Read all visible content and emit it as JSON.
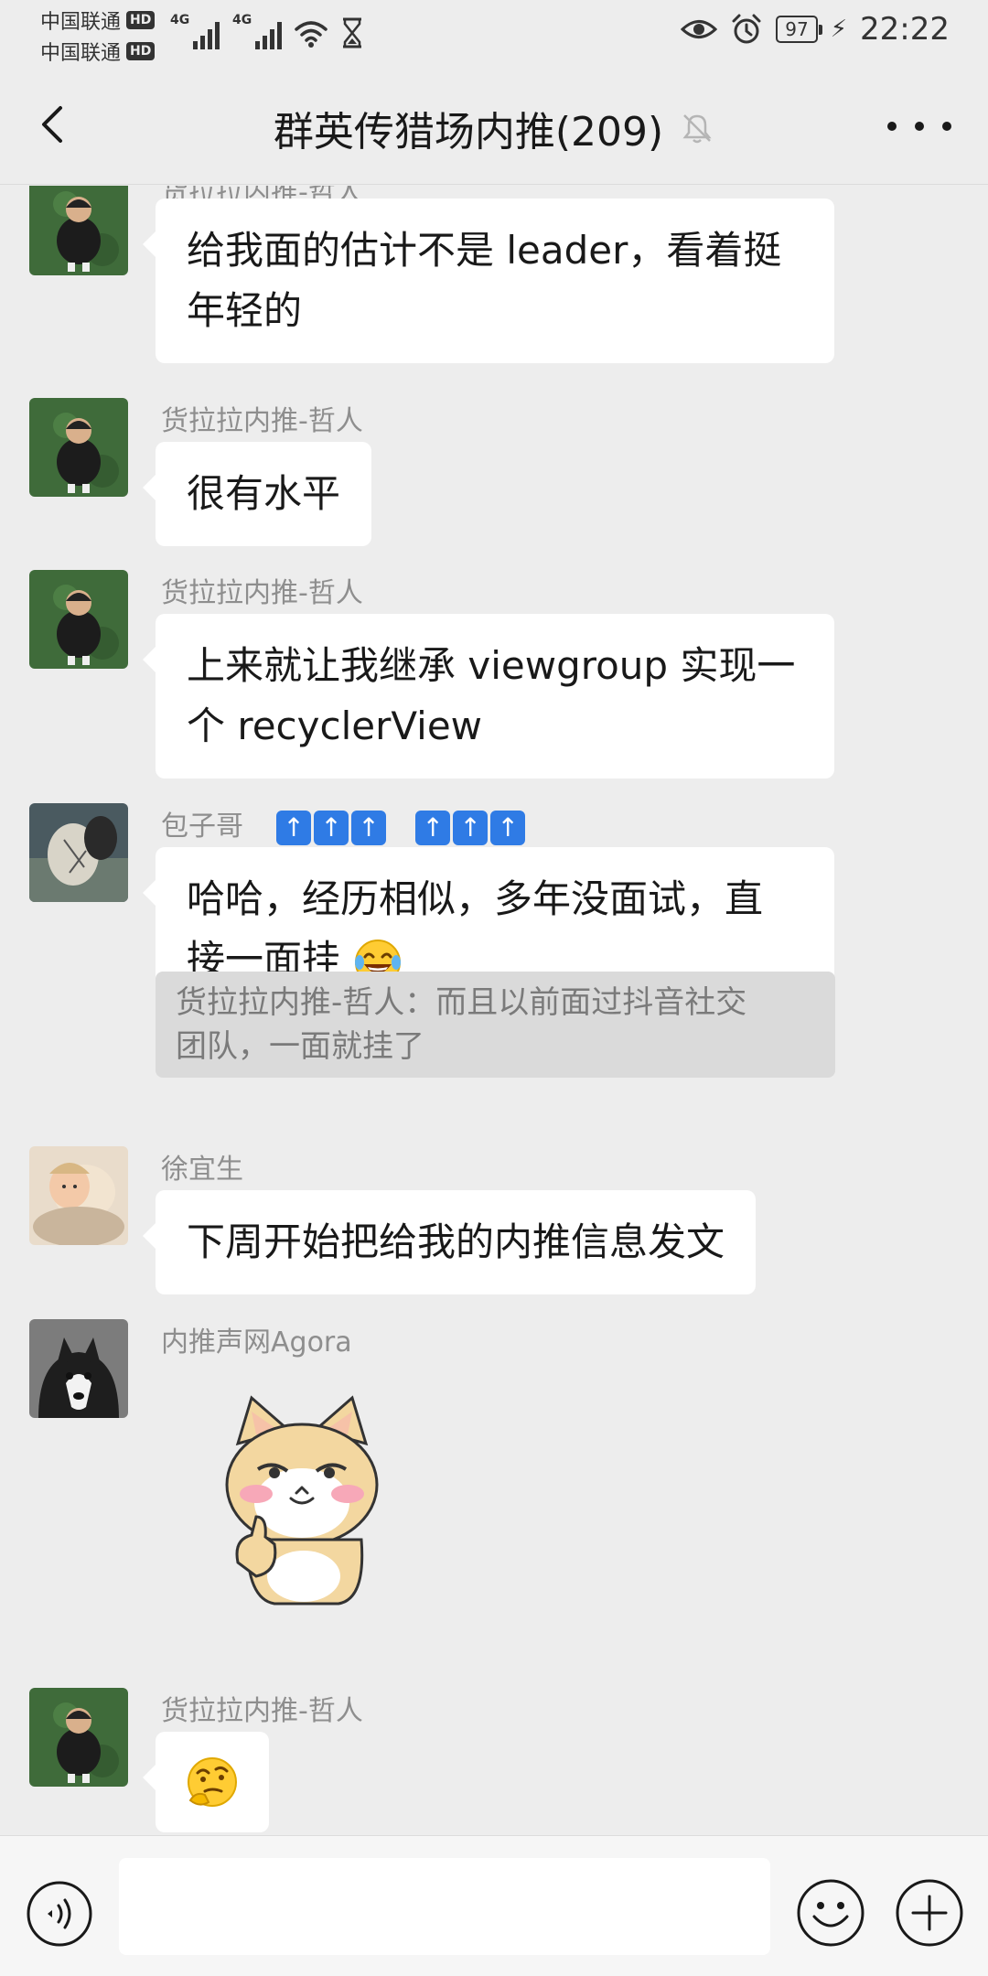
{
  "status_bar": {
    "carrier1": "中国联通",
    "carrier2": "中国联通",
    "hd_label": "HD",
    "network_tag": "4G",
    "battery": "97",
    "time": "22:22"
  },
  "header": {
    "title": "群英传猎场内推(209)",
    "muted": true
  },
  "messages": [
    {
      "sender": "货拉拉内推-哲人",
      "lines": [
        "给我面的估计不是 leader，看着挺",
        "年轻的"
      ]
    },
    {
      "sender": "货拉拉内推-哲人",
      "lines": [
        "很有水平"
      ]
    },
    {
      "sender": "货拉拉内推-哲人",
      "lines": [
        "上来就让我继承 viewgroup 实现一",
        "个 recyclerView"
      ]
    },
    {
      "sender": "包子哥",
      "sender_badges": [
        "up-arrow-icon",
        "up-arrow-icon",
        "up-arrow-icon",
        "up-arrow-icon",
        "up-arrow-icon",
        "up-arrow-icon"
      ],
      "lines": [
        "哈哈，经历相似，多年没面试，直",
        "接一面挂"
      ],
      "emoji": "tears-of-joy-emoji",
      "quote_lines": [
        "货拉拉内推-哲人：而且以前面过抖音社交",
        "团队，一面就挂了"
      ]
    },
    {
      "sender": "徐宜生",
      "lines": [
        "下周开始把给我的内推信息发文"
      ]
    },
    {
      "sender": "内推声网Agora",
      "sticker": "shiba-thumbs-up-sticker"
    },
    {
      "sender": "货拉拉内推-哲人",
      "emoji": "thinking-face-emoji"
    }
  ],
  "input_bar": {
    "placeholder": ""
  },
  "colors": {
    "background": "#ededed",
    "bubble": "#ffffff",
    "quote": "#dadada",
    "sender_name": "#8e8e8e",
    "badge_blue": "#2f7be5"
  }
}
